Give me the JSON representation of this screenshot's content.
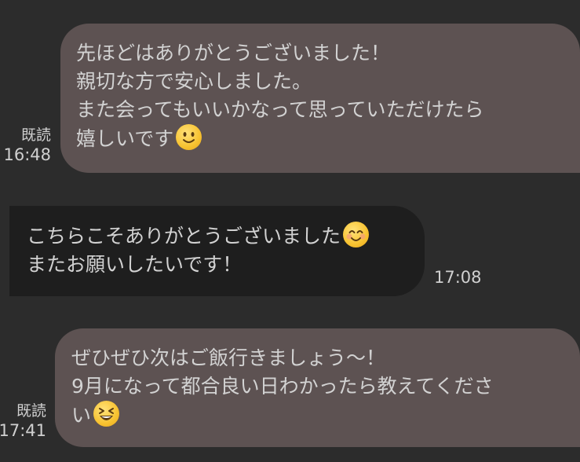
{
  "messages": [
    {
      "direction": "outgoing",
      "lines": [
        "先ほどはありがとうございました！",
        "親切な方で安心しました。",
        "また会ってもいいかなって思っていただけたら",
        "嬉しいです"
      ],
      "emoji": "slightly-smiling-face-emoji",
      "read_label": "既読",
      "time": "16:48"
    },
    {
      "direction": "incoming",
      "lines": [
        "こちらこそありがとうございました",
        "またお願いしたいです！"
      ],
      "emoji": "smiling-face-with-smiling-eyes-emoji",
      "time": "17:08"
    },
    {
      "direction": "outgoing",
      "lines": [
        "ぜひぜひ次はご飯行きましょう〜！",
        "9月になって都合良い日わかったら教えてくださ",
        "い"
      ],
      "emoji": "grinning-squinting-face-emoji",
      "read_label": "既読",
      "time": "17:41"
    }
  ],
  "colors": {
    "background": "#2c2c2c",
    "outgoing_bubble": "#5d5252",
    "incoming_bubble": "#1e1e1e",
    "text": "#d2d2d2"
  }
}
